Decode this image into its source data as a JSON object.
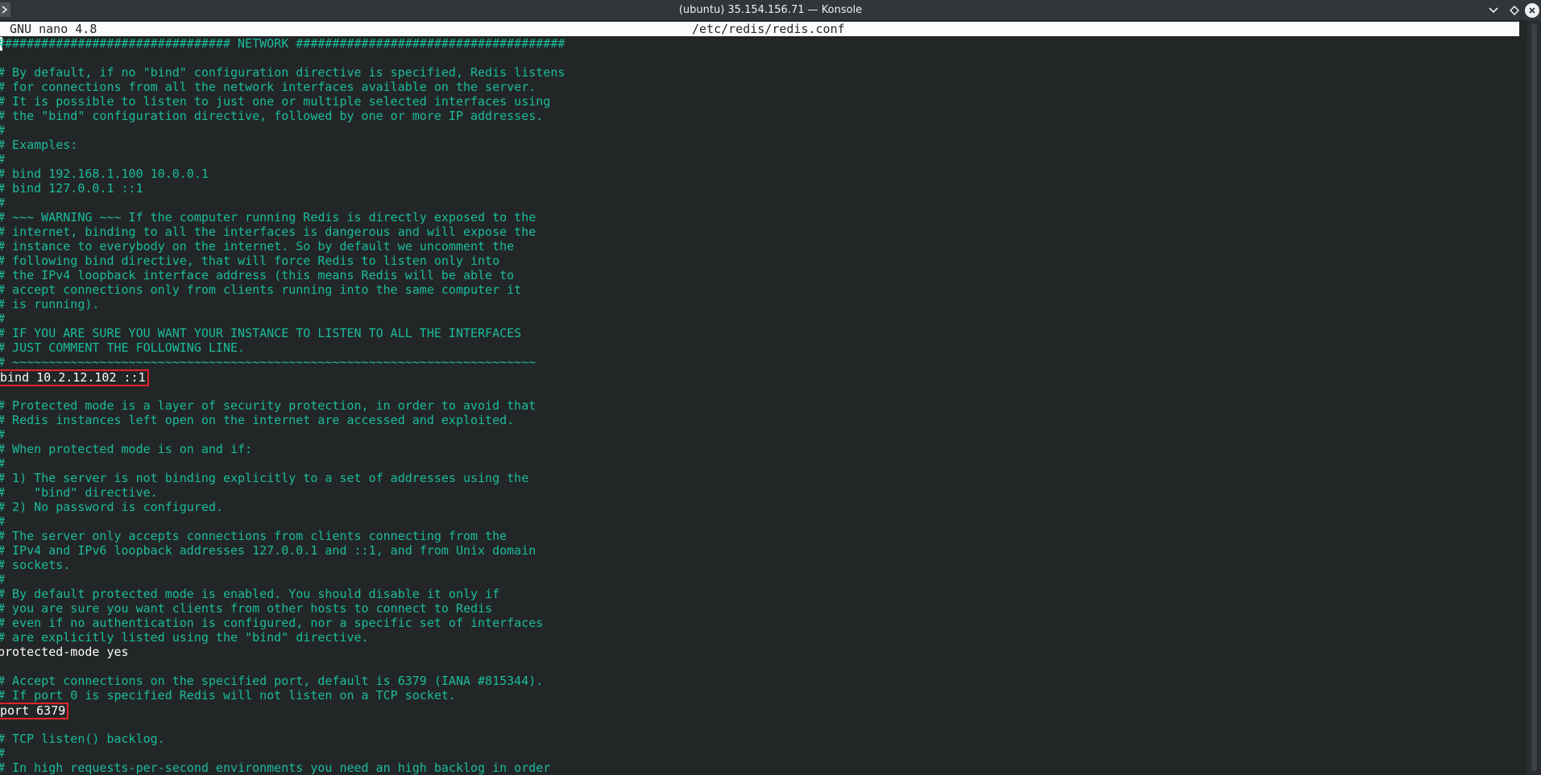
{
  "window": {
    "title": "(ubuntu) 35.154.156.71 — Konsole"
  },
  "nano": {
    "version": "GNU nano 4.8",
    "filename": "/etc/redis/redis.conf"
  },
  "colors": {
    "comment": "#1abc9c",
    "code": "#fcfcfc",
    "background": "#232627",
    "highlight_box": "#e0242b"
  },
  "icons": {
    "menu": "terminal-menu-icon",
    "minimize": "chevron-down-icon",
    "maximize": "diamond-icon",
    "close": "close-icon"
  },
  "lines": [
    {
      "text": "################################ NETWORK #####################################",
      "type": "comment"
    },
    {
      "text": "",
      "type": "comment"
    },
    {
      "text": "# By default, if no \"bind\" configuration directive is specified, Redis listens",
      "type": "comment"
    },
    {
      "text": "# for connections from all the network interfaces available on the server.",
      "type": "comment"
    },
    {
      "text": "# It is possible to listen to just one or multiple selected interfaces using",
      "type": "comment"
    },
    {
      "text": "# the \"bind\" configuration directive, followed by one or more IP addresses.",
      "type": "comment"
    },
    {
      "text": "#",
      "type": "comment"
    },
    {
      "text": "# Examples:",
      "type": "comment"
    },
    {
      "text": "#",
      "type": "comment"
    },
    {
      "text": "# bind 192.168.1.100 10.0.0.1",
      "type": "comment"
    },
    {
      "text": "# bind 127.0.0.1 ::1",
      "type": "comment"
    },
    {
      "text": "#",
      "type": "comment"
    },
    {
      "text": "# ~~~ WARNING ~~~ If the computer running Redis is directly exposed to the",
      "type": "comment"
    },
    {
      "text": "# internet, binding to all the interfaces is dangerous and will expose the",
      "type": "comment"
    },
    {
      "text": "# instance to everybody on the internet. So by default we uncomment the",
      "type": "comment"
    },
    {
      "text": "# following bind directive, that will force Redis to listen only into",
      "type": "comment"
    },
    {
      "text": "# the IPv4 loopback interface address (this means Redis will be able to",
      "type": "comment"
    },
    {
      "text": "# accept connections only from clients running into the same computer it",
      "type": "comment"
    },
    {
      "text": "# is running).",
      "type": "comment"
    },
    {
      "text": "#",
      "type": "comment"
    },
    {
      "text": "# IF YOU ARE SURE YOU WANT YOUR INSTANCE TO LISTEN TO ALL THE INTERFACES",
      "type": "comment"
    },
    {
      "text": "# JUST COMMENT THE FOLLOWING LINE.",
      "type": "comment"
    },
    {
      "text": "# ~~~~~~~~~~~~~~~~~~~~~~~~~~~~~~~~~~~~~~~~~~~~~~~~~~~~~~~~~~~~~~~~~~~~~~~~",
      "type": "comment"
    },
    {
      "text": "bind 10.2.12.102 ::1",
      "type": "code",
      "highlight": true
    },
    {
      "text": "",
      "type": "comment"
    },
    {
      "text": "# Protected mode is a layer of security protection, in order to avoid that",
      "type": "comment"
    },
    {
      "text": "# Redis instances left open on the internet are accessed and exploited.",
      "type": "comment"
    },
    {
      "text": "#",
      "type": "comment"
    },
    {
      "text": "# When protected mode is on and if:",
      "type": "comment"
    },
    {
      "text": "#",
      "type": "comment"
    },
    {
      "text": "# 1) The server is not binding explicitly to a set of addresses using the",
      "type": "comment"
    },
    {
      "text": "#    \"bind\" directive.",
      "type": "comment"
    },
    {
      "text": "# 2) No password is configured.",
      "type": "comment"
    },
    {
      "text": "#",
      "type": "comment"
    },
    {
      "text": "# The server only accepts connections from clients connecting from the",
      "type": "comment"
    },
    {
      "text": "# IPv4 and IPv6 loopback addresses 127.0.0.1 and ::1, and from Unix domain",
      "type": "comment"
    },
    {
      "text": "# sockets.",
      "type": "comment"
    },
    {
      "text": "#",
      "type": "comment"
    },
    {
      "text": "# By default protected mode is enabled. You should disable it only if",
      "type": "comment"
    },
    {
      "text": "# you are sure you want clients from other hosts to connect to Redis",
      "type": "comment"
    },
    {
      "text": "# even if no authentication is configured, nor a specific set of interfaces",
      "type": "comment"
    },
    {
      "text": "# are explicitly listed using the \"bind\" directive.",
      "type": "comment"
    },
    {
      "text": "protected-mode yes",
      "type": "code"
    },
    {
      "text": "",
      "type": "comment"
    },
    {
      "text": "# Accept connections on the specified port, default is 6379 (IANA #815344).",
      "type": "comment"
    },
    {
      "text": "# If port 0 is specified Redis will not listen on a TCP socket.",
      "type": "comment"
    },
    {
      "text": "port 6379",
      "type": "code",
      "highlight": true
    },
    {
      "text": "",
      "type": "comment"
    },
    {
      "text": "# TCP listen() backlog.",
      "type": "comment"
    },
    {
      "text": "#",
      "type": "comment"
    },
    {
      "text": "# In high requests-per-second environments you need an high backlog in order",
      "type": "comment"
    }
  ]
}
